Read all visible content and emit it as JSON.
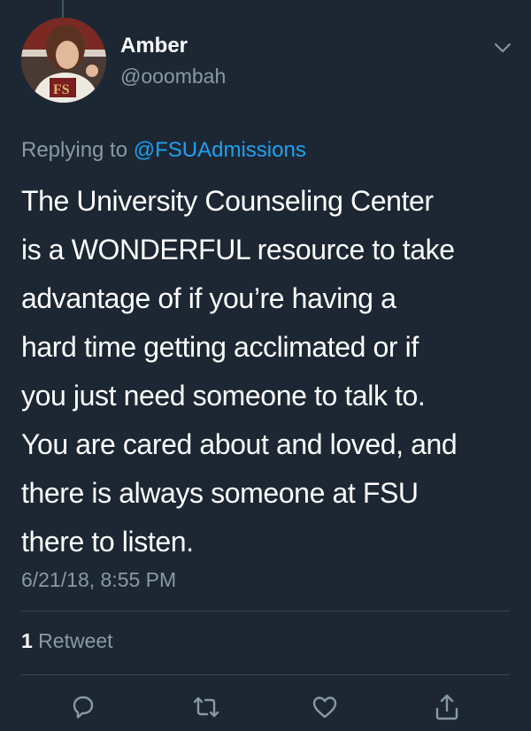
{
  "tweet": {
    "author": {
      "name": "Amber",
      "handle": "@ooombah"
    },
    "reply": {
      "prefix": "Replying to ",
      "mention": "@FSUAdmissions"
    },
    "text_lines": [
      "The University Counseling Center",
      "is a WONDERFUL resource to take",
      "advantage of if you’re having a",
      "hard time getting acclimated or if",
      "you just need someone to talk to.",
      "You are cared about and loved, and",
      "there is always someone at FSU",
      "there to listen."
    ],
    "timestamp": "6/21/18, 8:55 PM",
    "stats": {
      "retweet_count": "1",
      "retweet_label": " Retweet"
    }
  },
  "icons": {
    "menu": "chevron-down-icon",
    "reply": "reply-icon",
    "retweet": "retweet-icon",
    "like": "heart-icon",
    "share": "share-icon"
  },
  "colors": {
    "background": "#1c2733",
    "primary_text": "#ffffff",
    "secondary_text": "#8899a6",
    "link": "#1da1f2",
    "divider": "#38444d"
  }
}
